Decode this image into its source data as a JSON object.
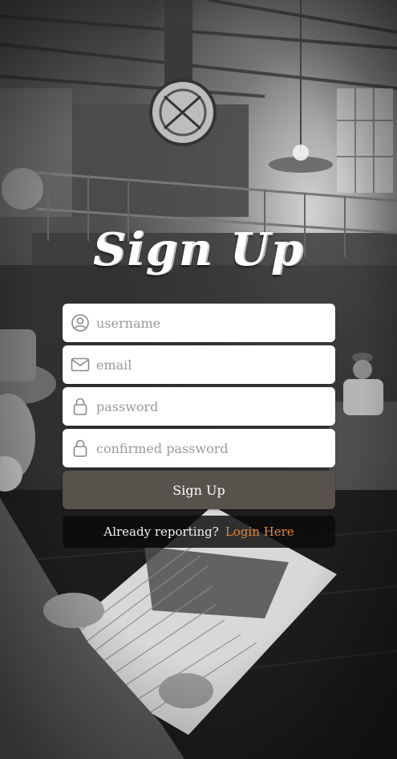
{
  "page": {
    "title": "Sign Up"
  },
  "form": {
    "username": {
      "placeholder": "username",
      "value": "",
      "icon": "user-circle-icon"
    },
    "email": {
      "placeholder": "email",
      "value": "",
      "icon": "envelope-icon"
    },
    "password": {
      "placeholder": "password",
      "value": "",
      "icon": "lock-icon"
    },
    "confirm_password": {
      "placeholder": "confirmed password",
      "value": "",
      "icon": "lock-icon"
    },
    "submit_label": "Sign Up"
  },
  "login": {
    "prompt": "Already reporting?",
    "link_label": "Login Here",
    "link_color": "#e0883f"
  },
  "colors": {
    "button_bg": "#57524b",
    "field_bg": "#ffffff",
    "icon_gray": "#8a8a8a"
  }
}
